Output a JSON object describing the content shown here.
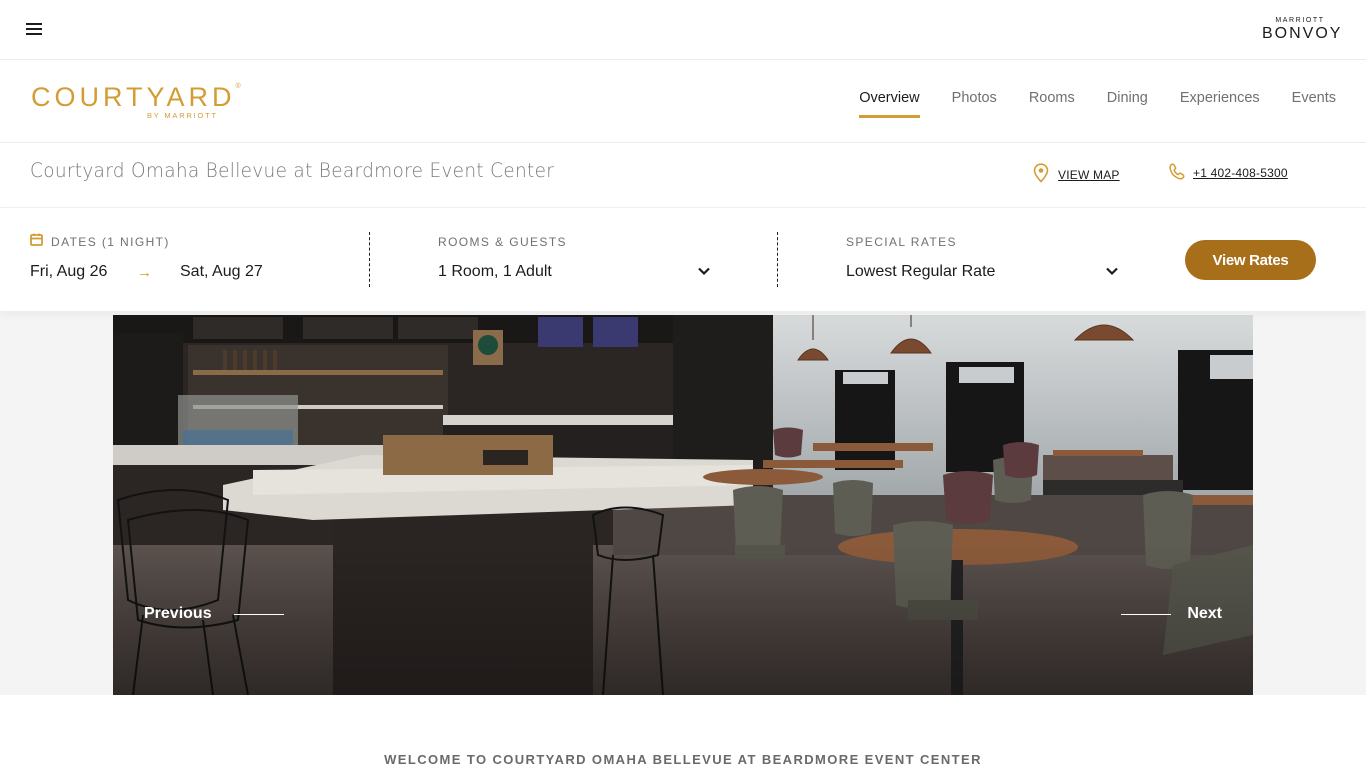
{
  "topbar": {
    "menu_icon": "hamburger-menu-icon",
    "bonvoy_small": "MARRIOTT",
    "bonvoy_big": "BONVOY"
  },
  "brand": {
    "name": "COURTYARD",
    "registered": "®",
    "by": "BY MARRIOTT",
    "color": "#d39d33"
  },
  "nav": {
    "items": [
      {
        "label": "Overview",
        "active": true
      },
      {
        "label": "Photos",
        "active": false
      },
      {
        "label": "Rooms",
        "active": false
      },
      {
        "label": "Dining",
        "active": false
      },
      {
        "label": "Experiences",
        "active": false
      },
      {
        "label": "Events",
        "active": false
      }
    ]
  },
  "hotel": {
    "name": "Courtyard Omaha Bellevue at Beardmore Event Center",
    "view_map_label": "VIEW MAP",
    "map_icon": "map-pin-icon",
    "phone": "+1 402-408-5300",
    "phone_icon": "phone-icon"
  },
  "search": {
    "dates_label": "DATES (1 NIGHT)",
    "date_from": "Fri, Aug 26",
    "date_arrow": "→",
    "date_to": "Sat, Aug 27",
    "rooms_label": "ROOMS & GUESTS",
    "rooms_value": "1 Room, 1 Adult",
    "rates_label": "SPECIAL RATES",
    "rates_value": "Lowest Regular Rate",
    "view_rates_label": "View Rates",
    "button_color": "#a86f1b"
  },
  "carousel": {
    "previous_label": "Previous",
    "next_label": "Next",
    "image_description": "Courtyard bistro bar and dining area with Starbucks counter, wire bar stools, and wood tables"
  },
  "welcome": {
    "heading": "WELCOME TO COURTYARD OMAHA BELLEVUE AT BEARDMORE EVENT CENTER"
  }
}
